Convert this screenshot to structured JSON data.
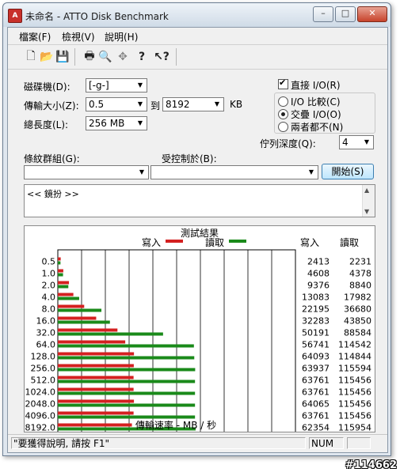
{
  "window": {
    "title": "未命名 - ATTO Disk Benchmark",
    "app_icon_label": "A",
    "minimize": "–",
    "maximize": "□",
    "close": "✕"
  },
  "menu": [
    "檔案(F)",
    "檢視(V)",
    "說明(H)"
  ],
  "toolbar": {
    "icons": [
      "new-file-icon",
      "open-folder-icon",
      "save-icon",
      "print-icon",
      "print-preview-icon",
      "move-icon",
      "help-icon",
      "context-help-icon"
    ],
    "glyphs": [
      "🗋",
      "📂",
      "💾",
      "🖶",
      "🔍",
      "✥",
      "?",
      "↖?"
    ]
  },
  "settings": {
    "drive_label": "磁碟機(D):",
    "drive_value": "[-g-]",
    "transfer_size_label": "傳輸大小(Z):",
    "transfer_from": "0.5",
    "to_label": "到",
    "transfer_to": "8192",
    "unit_label": "KB",
    "total_length_label": "總長度(L):",
    "total_length_value": "256 MB",
    "direct_io_label": "直接 I/O(R)",
    "direct_io_checked": true,
    "io_options": [
      {
        "label": "I/O 比較(C)",
        "selected": false
      },
      {
        "label": "交疊 I/O(O)",
        "selected": true
      },
      {
        "label": "兩者都不(N)",
        "selected": false
      }
    ],
    "queue_depth_label": "佇列深度(Q):",
    "queue_depth_value": "4"
  },
  "pattern": {
    "pattern_label": "條紋群組(G):",
    "controlled_by_label": "受控制於(B):",
    "start_button": "開始(S)"
  },
  "notes": {
    "text": "<< 鏡扮 >>"
  },
  "chart_data": {
    "type": "bar",
    "title": "測試結果",
    "xlabel": "傳輸速率 - MB / 秒",
    "ylabel": "",
    "xlim": [
      0,
      200
    ],
    "x_ticks": [
      "0",
      "20",
      "40",
      "60",
      "80",
      "100",
      "120",
      "140",
      "160",
      "180",
      "200"
    ],
    "categories": [
      "0.5",
      "1.0",
      "2.0",
      "4.0",
      "8.0",
      "16.0",
      "32.0",
      "64.0",
      "128.0",
      "256.0",
      "512.0",
      "1024.0",
      "2048.0",
      "4096.0",
      "8192.0"
    ],
    "series": [
      {
        "name": "寫入",
        "color": "#d42020",
        "values": [
          2.413,
          4.608,
          9.376,
          13.083,
          22.195,
          32.283,
          50.191,
          56.741,
          64.093,
          63.937,
          63.761,
          63.761,
          64.065,
          63.761,
          62.354
        ]
      },
      {
        "name": "讀取",
        "color": "#1a8a1a",
        "values": [
          2.231,
          4.378,
          8.84,
          17.982,
          36.68,
          43.85,
          88.584,
          114.542,
          114.844,
          115.594,
          115.456,
          115.456,
          115.456,
          115.456,
          115.954
        ]
      }
    ],
    "legend": "top-center",
    "table_headers": [
      "寫入",
      "讀取"
    ],
    "write_values": [
      "2413",
      "4608",
      "9376",
      "13083",
      "22195",
      "32283",
      "50191",
      "56741",
      "64093",
      "63937",
      "63761",
      "63761",
      "64065",
      "63761",
      "62354"
    ],
    "read_values": [
      "2231",
      "4378",
      "8840",
      "17982",
      "36680",
      "43850",
      "88584",
      "114542",
      "114844",
      "115594",
      "115456",
      "115456",
      "115456",
      "115456",
      "115954"
    ]
  },
  "status": {
    "help_text": "\"要獲得說明, 請按 F1\"",
    "num": "NUM"
  },
  "watermark": "#114662"
}
